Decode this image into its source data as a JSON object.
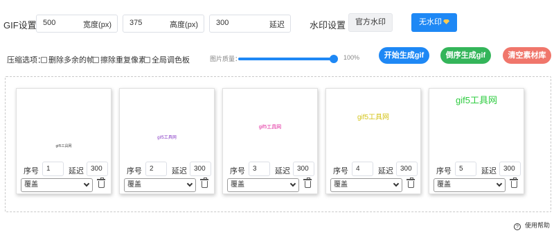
{
  "settings": {
    "label": "GIF设置：",
    "width": {
      "value": "500",
      "suffix": "宽度(px)"
    },
    "height": {
      "value": "375",
      "suffix": "高度(px)"
    },
    "delay": {
      "value": "300",
      "suffix": "延迟"
    },
    "watermark_label": "水印设置",
    "official_watermark": "官方水印",
    "no_watermark": "无水印"
  },
  "compress": {
    "label": "压缩选项：",
    "options": [
      "删除多余的帧",
      "擦除重复像素",
      "全局调色板"
    ],
    "quality_label": "图片质量：",
    "quality_value": "100%",
    "quality_percent": 100
  },
  "actions": {
    "start": "开始生成gif",
    "reverse": "倒序生成gif",
    "clear": "清空素材库"
  },
  "colors": {
    "primary": "#1e88f5",
    "start_pill": "#1e88f5",
    "reverse_pill": "#34b55a",
    "clear_pill": "#f0766b"
  },
  "frame_labels": {
    "seq": "序号",
    "delay": "延迟"
  },
  "frames": [
    {
      "seq": "1",
      "delay": "300",
      "mode": "覆盖",
      "preview_text": "gif5工具网",
      "preview_color": "#444444"
    },
    {
      "seq": "2",
      "delay": "300",
      "mode": "覆盖",
      "preview_text": "gif5工具网",
      "preview_color": "#8a3fc7"
    },
    {
      "seq": "3",
      "delay": "300",
      "mode": "覆盖",
      "preview_text": "gif5工具网",
      "preview_color": "#e0219a"
    },
    {
      "seq": "4",
      "delay": "300",
      "mode": "覆盖",
      "preview_text": "gif5工具网",
      "preview_color": "#d4c41a"
    },
    {
      "seq": "5",
      "delay": "300",
      "mode": "覆盖",
      "preview_text": "gif5工具网",
      "preview_color": "#2ecc40"
    }
  ],
  "help": "使用帮助"
}
